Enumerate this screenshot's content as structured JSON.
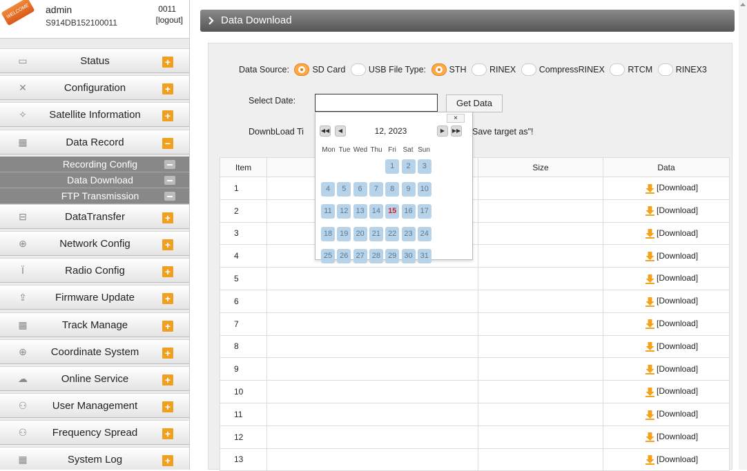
{
  "user": {
    "ribbon": "WELCOME",
    "name": "admin",
    "serial": "S914DB152100011",
    "id": "0011",
    "logout": "[logout]"
  },
  "menu": [
    {
      "label": "Status",
      "icon": "monitor-icon",
      "toggle": "+"
    },
    {
      "label": "Configuration",
      "icon": "tools-icon",
      "toggle": "+"
    },
    {
      "label": "Satellite Information",
      "icon": "satellite-icon",
      "toggle": "+"
    },
    {
      "label": "Data Record",
      "icon": "calendar-icon",
      "toggle": "-"
    }
  ],
  "submenu": [
    "Recording Config",
    "Data Download",
    "FTP Transmission"
  ],
  "menu2": [
    {
      "label": "DataTransfer",
      "icon": "computer-icon",
      "toggle": "+"
    },
    {
      "label": "Network Config",
      "icon": "globe-icon",
      "toggle": "+"
    },
    {
      "label": "Radio Config",
      "icon": "antenna-icon",
      "toggle": "+"
    },
    {
      "label": "Firmware Update",
      "icon": "upload-icon",
      "toggle": "+"
    },
    {
      "label": "Track Manage",
      "icon": "calendar-icon",
      "toggle": "+"
    },
    {
      "label": "Coordinate System",
      "icon": "globe-icon",
      "toggle": "+"
    },
    {
      "label": "Online Service",
      "icon": "cloud-icon",
      "toggle": "+"
    },
    {
      "label": "User Management",
      "icon": "users-icon",
      "toggle": "+"
    },
    {
      "label": "Frequency Spread",
      "icon": "users-icon",
      "toggle": "+"
    },
    {
      "label": "System Log",
      "icon": "calendar-icon",
      "toggle": "+"
    }
  ],
  "header": {
    "title": "Data Download"
  },
  "form": {
    "source_label": "Data Source:",
    "sources": [
      "SD Card",
      "USB"
    ],
    "selected_source": "SD Card",
    "filetype_label": "File Type:",
    "filetypes": [
      "STH",
      "RINEX",
      "CompressRINEX",
      "RTCM",
      "RINEX3"
    ],
    "selected_filetype": "STH",
    "date_label": "Select Date:",
    "date_value": "",
    "get_button": "Get Data",
    "download_tip": "DownbLoad Ti",
    "save_tip": "Save target as\"!"
  },
  "calendar": {
    "close": "×",
    "title": "12, 2023",
    "weekdays": [
      "Mon",
      "Tue",
      "Wed",
      "Thu",
      "Fri",
      "Sat",
      "Sun"
    ],
    "days": [
      "1",
      "2",
      "3",
      "4",
      "5",
      "6",
      "7",
      "8",
      "9",
      "10",
      "11",
      "12",
      "13",
      "14",
      "15",
      "16",
      "17",
      "18",
      "19",
      "20",
      "21",
      "22",
      "23",
      "24",
      "25",
      "26",
      "27",
      "28",
      "29",
      "30",
      "31"
    ],
    "first_weekday_index": 4,
    "today": "15"
  },
  "table": {
    "headers": [
      "Item",
      "",
      "Size",
      "Data"
    ],
    "rows": [
      "1",
      "2",
      "3",
      "4",
      "5",
      "6",
      "7",
      "8",
      "9",
      "10",
      "11",
      "12",
      "13"
    ],
    "download_label": "[Download]"
  }
}
